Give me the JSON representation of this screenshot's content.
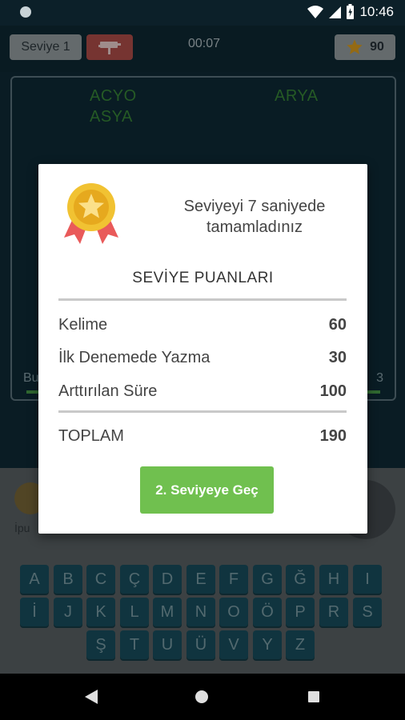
{
  "status_bar": {
    "time": "10:46"
  },
  "topbar": {
    "level_label": "Seviye 1",
    "timer": "00:07",
    "score": "90"
  },
  "board": {
    "words": [
      "ACYO",
      "ARYA",
      "ASYA"
    ],
    "corner_left": "Bu",
    "corner_right": "3"
  },
  "lower": {
    "hint_label": "İpu"
  },
  "keyboard": {
    "rows": [
      [
        "A",
        "B",
        "C",
        "Ç",
        "D",
        "E",
        "F",
        "G",
        "Ğ",
        "H",
        "I"
      ],
      [
        "İ",
        "J",
        "K",
        "L",
        "M",
        "N",
        "O",
        "Ö",
        "P",
        "R",
        "S"
      ],
      [
        "Ş",
        "T",
        "U",
        "Ü",
        "V",
        "Y",
        "Z"
      ]
    ]
  },
  "modal": {
    "message_line1": "Seviyeyi 7 saniyede",
    "message_line2": "tamamladınız",
    "section_title": "SEVİYE PUANLARI",
    "rows": [
      {
        "label": "Kelime",
        "value": "60"
      },
      {
        "label": "İlk Denemede Yazma",
        "value": "30"
      },
      {
        "label": "Arttırılan Süre",
        "value": "100"
      }
    ],
    "total_label": "TOPLAM",
    "total_value": "190",
    "next_button": "2. Seviyeye Geç"
  },
  "colors": {
    "accent_green": "#70c04f",
    "word_green": "#3a8a3a",
    "key_bg": "#1a5161",
    "star": "#f2b21d"
  }
}
